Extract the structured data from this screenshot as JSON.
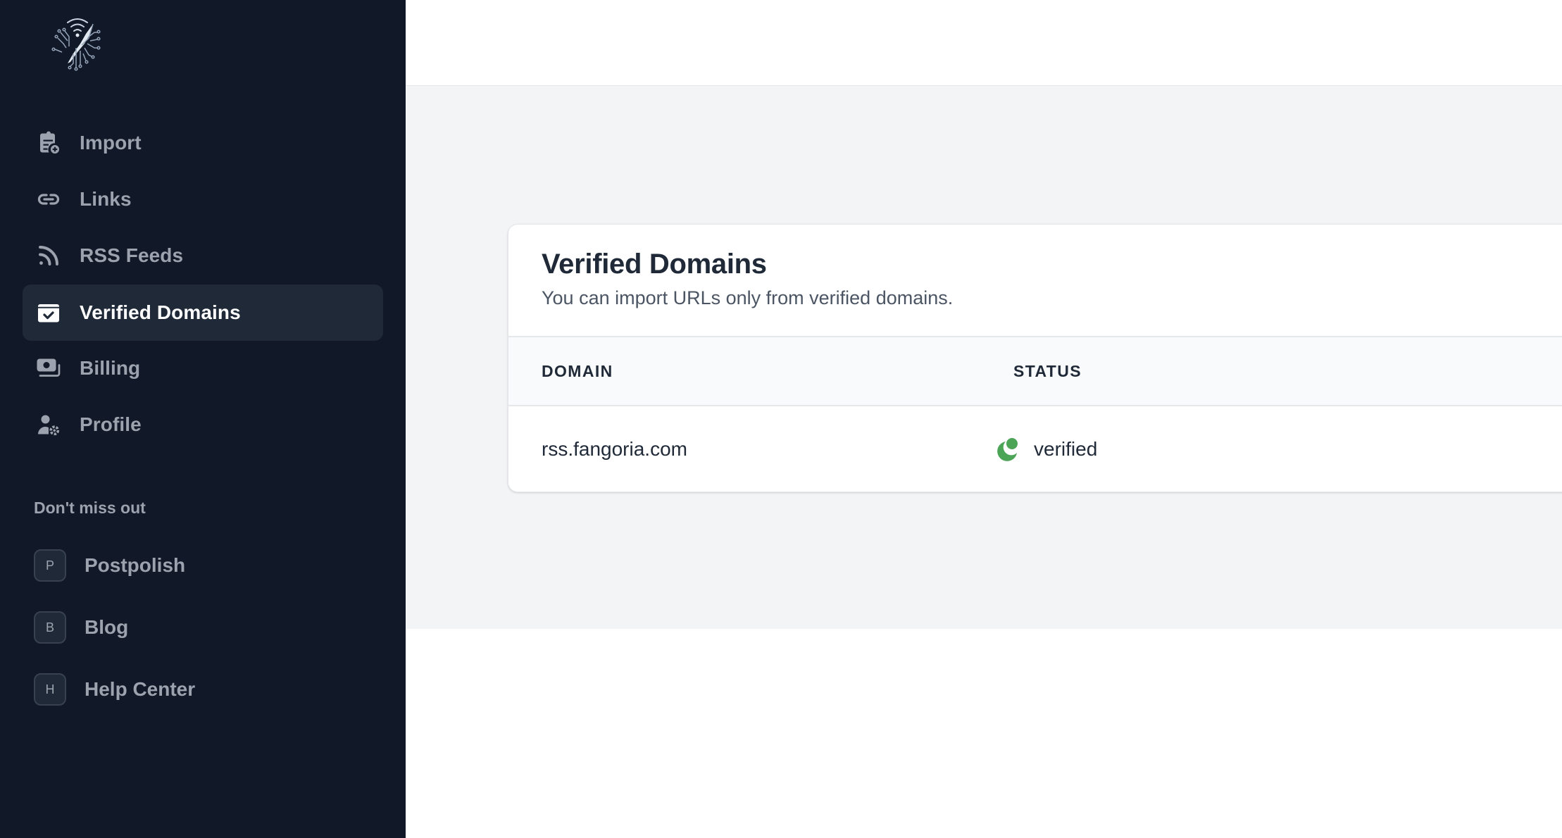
{
  "app": {
    "logo": "feather-circuit-logo"
  },
  "sidebar": {
    "nav": [
      {
        "label": "Import",
        "icon": "clipboard-plus-icon",
        "active": false
      },
      {
        "label": "Links",
        "icon": "link-icon",
        "active": false
      },
      {
        "label": "RSS Feeds",
        "icon": "rss-icon",
        "active": false
      },
      {
        "label": "Verified Domains",
        "icon": "calendar-check-icon",
        "active": true
      },
      {
        "label": "Billing",
        "icon": "banknotes-icon",
        "active": false
      },
      {
        "label": "Profile",
        "icon": "user-gear-icon",
        "active": false
      }
    ],
    "section_label": "Don't miss out",
    "external": [
      {
        "initial": "P",
        "label": "Postpolish"
      },
      {
        "initial": "B",
        "label": "Blog"
      },
      {
        "initial": "H",
        "label": "Help Center"
      }
    ]
  },
  "card": {
    "title": "Verified Domains",
    "subtitle": "You can import URLs only from verified domains.",
    "table": {
      "columns": [
        "DOMAIN",
        "STATUS"
      ],
      "rows": [
        {
          "domain": "rss.fangoria.com",
          "status": "verified",
          "status_color": "#4ca457"
        }
      ]
    }
  },
  "colors": {
    "sidebar_bg": "#111827",
    "active_item_bg": "#1f2937",
    "verified_green": "#4ca457"
  }
}
